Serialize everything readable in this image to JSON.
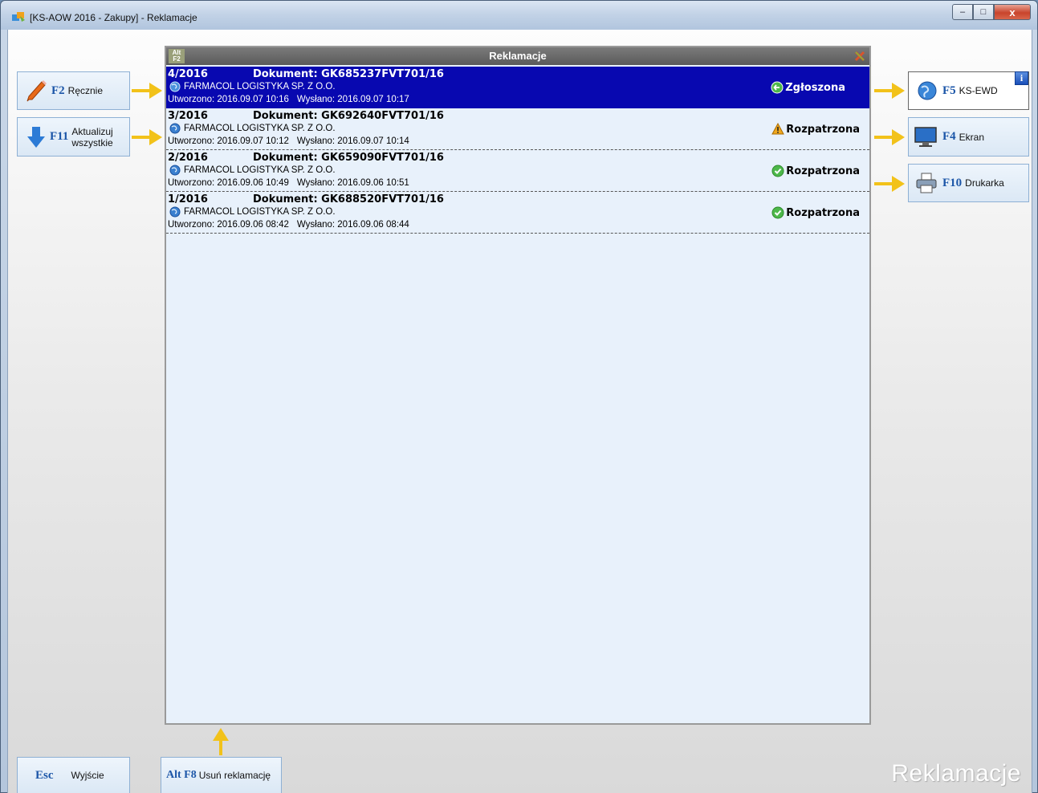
{
  "window": {
    "title": "[KS-AOW 2016 - Zakupy] - Reklamacje",
    "minimize": "–",
    "maximize": "□",
    "close": "x"
  },
  "panel": {
    "title": "Reklamacje",
    "shortcut_top": "Alt",
    "shortcut_bottom": "F2"
  },
  "left_buttons": [
    {
      "key": "F2",
      "label": "Ręcznie"
    },
    {
      "key": "F11",
      "label_line1": "Aktualizuj",
      "label_line2": "wszystkie"
    }
  ],
  "right_buttons": [
    {
      "key": "F5",
      "label": "KS-EWD"
    },
    {
      "key": "F4",
      "label": "Ekran"
    },
    {
      "key": "F10",
      "label": "Drukarka"
    }
  ],
  "info_badge": "i",
  "bottom_buttons": [
    {
      "key": "Esc",
      "label": "Wyjście"
    },
    {
      "key": "Alt F8",
      "label": "Usuń reklamację"
    }
  ],
  "rows": [
    {
      "number": "4/2016",
      "document": "Dokument: GK685237FVT701/16",
      "company": "FARMACOL LOGISTYKA SP. Z O.O.",
      "created": "Utworzono: 2016.09.07 10:16",
      "sent": "Wysłano: 2016.09.07 10:17",
      "status": "Zgłoszona",
      "status_icon": "arrow-left-circle-icon"
    },
    {
      "number": "3/2016",
      "document": "Dokument: GK692640FVT701/16",
      "company": "FARMACOL LOGISTYKA SP. Z O.O.",
      "created": "Utworzono: 2016.09.07 10:12",
      "sent": "Wysłano: 2016.09.07 10:14",
      "status": "Rozpatrzona",
      "status_icon": "warning-icon"
    },
    {
      "number": "2/2016",
      "document": "Dokument: GK659090FVT701/16",
      "company": "FARMACOL LOGISTYKA SP. Z O.O.",
      "created": "Utworzono: 2016.09.06 10:49",
      "sent": "Wysłano: 2016.09.06 10:51",
      "status": "Rozpatrzona",
      "status_icon": "check-circle-icon"
    },
    {
      "number": "1/2016",
      "document": "Dokument: GK688520FVT701/16",
      "company": "FARMACOL LOGISTYKA SP. Z O.O.",
      "created": "Utworzono: 2016.09.06 08:42",
      "sent": "Wysłano: 2016.09.06 08:44",
      "status": "Rozpatrzona",
      "status_icon": "check-circle-icon"
    }
  ],
  "watermark": "Reklamacje",
  "colors": {
    "selection": "#0808b0",
    "key_blue": "#1c56a8",
    "arrow_yellow": "#f2c21a"
  }
}
